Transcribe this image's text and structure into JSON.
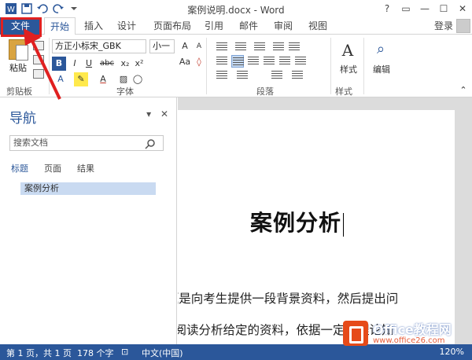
{
  "window": {
    "title": "案例说明.docx - Word",
    "controls": [
      "?",
      "▭",
      "—",
      "☐",
      "✕"
    ],
    "login": "登录"
  },
  "qat": {
    "icons": [
      "word-logo",
      "save-icon",
      "undo-icon",
      "redo-icon",
      "customize-icon"
    ]
  },
  "tabs": {
    "file": "文件",
    "items": [
      "开始",
      "插入",
      "设计",
      "页面布局",
      "引用",
      "邮件",
      "审阅",
      "视图"
    ],
    "active": "开始"
  },
  "ribbon": {
    "clipboard": {
      "paste": "粘贴",
      "label": "剪贴板"
    },
    "font": {
      "label": "字体",
      "font_name": "方正小标宋_GBK",
      "font_size": "小一",
      "buttons": [
        "B",
        "I",
        "U",
        "abc",
        "x₂",
        "x²",
        "A",
        "A",
        "Aa",
        "A",
        "A"
      ]
    },
    "paragraph": {
      "label": "段落"
    },
    "styles": {
      "label": "样式",
      "button": "样式"
    },
    "editing": {
      "button": "编辑"
    }
  },
  "nav": {
    "title": "导航",
    "search_placeholder": "搜索文档",
    "tabs": [
      "标题",
      "页面",
      "结果"
    ],
    "headings": [
      "案例分析"
    ]
  },
  "document": {
    "heading": "案例分析",
    "lines": [
      "f题是向考生提供一段背景资料，然后提出问",
      "上阅读分析给定的资料，依据一定的理论知"
    ]
  },
  "status": {
    "page": "第 1 页，共 1 页",
    "words": "178 个字",
    "lang": "中文(中国)",
    "zoom": "120%"
  },
  "watermark": {
    "brand": "Office教程网",
    "url": "www.office26.com"
  },
  "colors": {
    "accent": "#2b579a",
    "highlight": "#e02020"
  }
}
